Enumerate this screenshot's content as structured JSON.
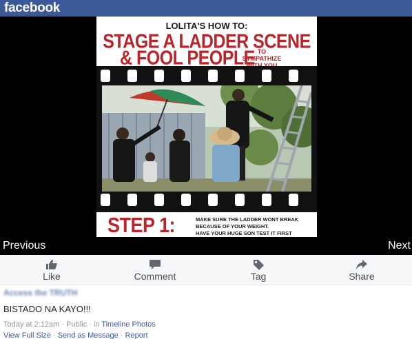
{
  "brand": "facebook",
  "photo": {
    "header_top": "LOLITA'S HOW TO:",
    "header_line1": "STAGE A LADDER SCENE",
    "header_line2": "& FOOL PEOPLE",
    "header_side": "TO SYMPATHIZE WITH YOU",
    "step_label": "STEP 1:",
    "step_text_1": "MAKE SURE THE LADDER WONT BREAK",
    "step_text_2": "BECAUSE OF YOUR WEIGHT.",
    "step_text_3": "HAVE YOUR HUGE SON TEST IT FIRST",
    "colors": {
      "accent": "#b8262b",
      "film": "#111111"
    }
  },
  "nav": {
    "previous": "Previous",
    "next": "Next"
  },
  "actions": [
    {
      "label": "Like",
      "icon": "thumbs-up-icon"
    },
    {
      "label": "Comment",
      "icon": "comment-icon"
    },
    {
      "label": "Tag",
      "icon": "tag-icon"
    },
    {
      "label": "Share",
      "icon": "share-icon"
    }
  ],
  "post": {
    "poster": "Access the TRUTH",
    "message": "BISTADO NA KAYO!!!",
    "time": "Today at 2:12am",
    "privacy": "Public",
    "in_text": "in",
    "album": "Timeline Photos",
    "links": [
      "View Full Size",
      "Send as Message",
      "Report"
    ]
  },
  "colors": {
    "facebook_blue": "#3b5998",
    "action_bar": "#f6f7f9"
  }
}
